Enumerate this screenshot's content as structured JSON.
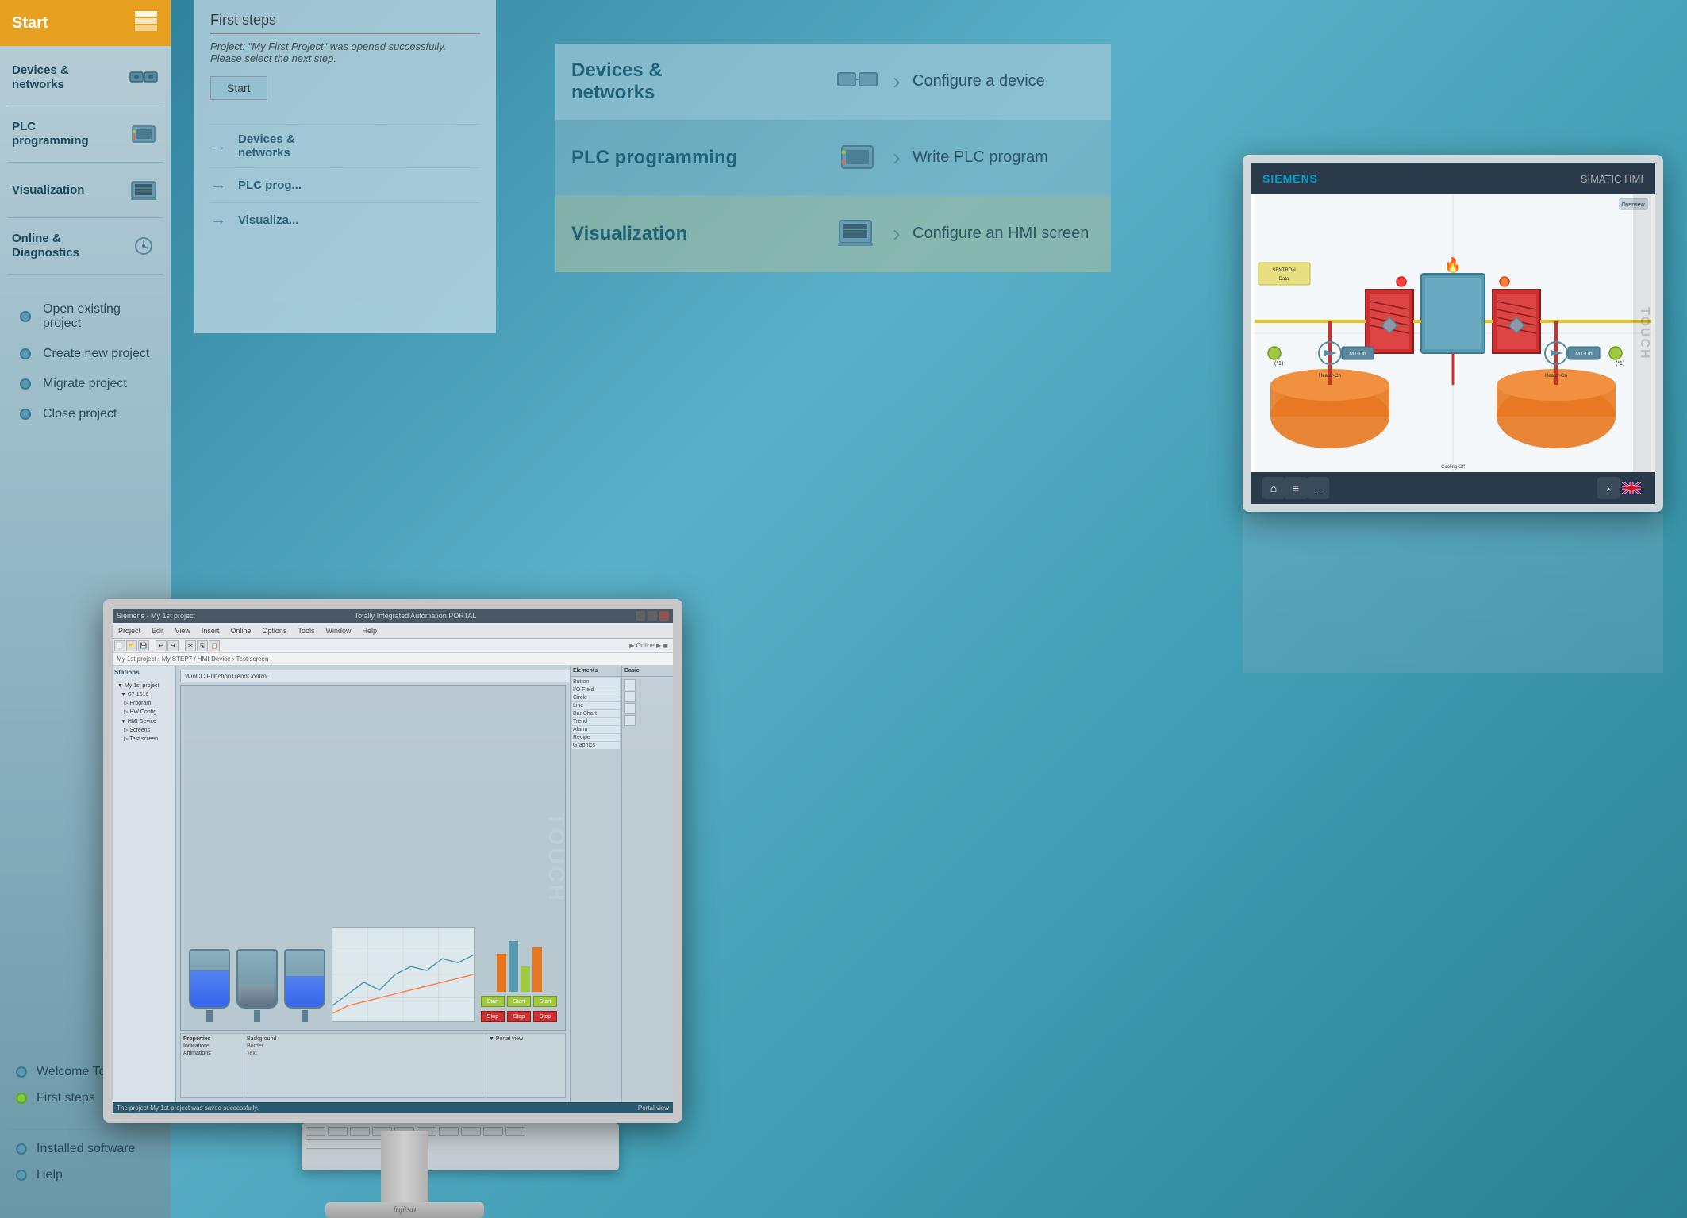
{
  "background": {
    "color": "#4a9ab5"
  },
  "sidebar": {
    "title": "Start",
    "items": [
      {
        "id": "devices-networks",
        "label": "Devices &\nnetworks",
        "active": false
      },
      {
        "id": "plc-programming",
        "label": "PLC\nprogramming",
        "active": false
      },
      {
        "id": "visualization",
        "label": "Visualization",
        "active": false
      },
      {
        "id": "online-diagnostics",
        "label": "Online &\nDiagnostics",
        "active": false
      }
    ],
    "bottom_items": [
      {
        "id": "installed-software",
        "label": "Installed software"
      },
      {
        "id": "help",
        "label": "Help"
      }
    ]
  },
  "menu_items": [
    {
      "id": "open-project",
      "label": "Open existing project",
      "dot": "default"
    },
    {
      "id": "create-project",
      "label": "Create new project",
      "dot": "default"
    },
    {
      "id": "migrate-project",
      "label": "Migrate project",
      "dot": "default"
    },
    {
      "id": "close-project",
      "label": "Close project",
      "dot": "default"
    }
  ],
  "tour_items": [
    {
      "id": "welcome-tour",
      "label": "Welcome Tour",
      "dot": "default"
    },
    {
      "id": "first-steps",
      "label": "First steps",
      "dot": "green"
    }
  ],
  "first_steps": {
    "title": "First steps",
    "project_info": "Project: \"My First Project\" was opened successfully. Please select the next step.",
    "start_label": "Start"
  },
  "portal_nav": [
    {
      "id": "devices-networks-nav",
      "label": "Devices &\nnetworks"
    },
    {
      "id": "plc-prog-nav",
      "label": "PLC prog..."
    },
    {
      "id": "visualization-nav",
      "label": "Visualiza..."
    }
  ],
  "workflow": {
    "title": "First steps",
    "items": [
      {
        "id": "devices-networks-wf",
        "title": "Devices &\nnetworks",
        "action": "Configure a device",
        "icon": "network-icon"
      },
      {
        "id": "plc-programming-wf",
        "title": "PLC programming",
        "action": "Write PLC program",
        "icon": "plc-icon"
      },
      {
        "id": "visualization-wf",
        "title": "Visualization",
        "action": "Configure an HMI screen",
        "icon": "hmi-icon"
      }
    ]
  },
  "monitor": {
    "brand": "fujitsu",
    "tia_portal": {
      "title": "Siemens - My 1st project",
      "menubar_items": [
        "Project",
        "Edit",
        "View",
        "Insert",
        "Online",
        "Options",
        "Tools",
        "Window",
        "Help"
      ],
      "breadcrumb": "My 1st project › My STEP7 / HMI-Device › Test screen"
    }
  },
  "hmi_panel": {
    "brand": "SIEMENS",
    "model": "SIMATIC HMI",
    "touch_label": "TOUCH"
  },
  "colors": {
    "orange_accent": "#e87820",
    "teal_bg": "#4a9ab5",
    "sidebar_bg": "#a8c0cc",
    "active_green": "#a0c840",
    "workflow_blue": "#1a5a70",
    "portal_blue": "#2a6a80"
  }
}
